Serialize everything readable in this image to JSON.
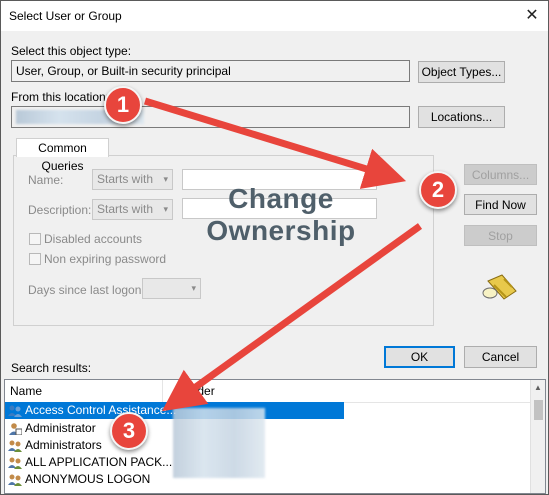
{
  "window": {
    "title": "Select User or Group"
  },
  "close_glyph": "✕",
  "object_type": {
    "label": "Select this object type:",
    "value": "User, Group, or Built-in security principal",
    "button": "Object Types..."
  },
  "location": {
    "label": "From this location:",
    "button": "Locations..."
  },
  "common_queries": {
    "tab": "Common Queries",
    "name_label": "Name:",
    "name_mode": "Starts with",
    "description_label": "Description:",
    "description_mode": "Starts with",
    "disabled_accounts": "Disabled accounts",
    "non_expiring": "Non expiring password",
    "days_label": "Days since last logon:"
  },
  "side_buttons": {
    "columns": "Columns...",
    "find_now": "Find Now",
    "stop": "Stop"
  },
  "ok_button": "OK",
  "cancel_button": "Cancel",
  "search_results": {
    "label": "Search results:",
    "columns": [
      "Name",
      "older"
    ],
    "rows": [
      "Access Control Assistance...",
      "Administrator",
      "Administrators",
      "ALL APPLICATION PACK...",
      "ANONYMOUS LOGON"
    ]
  },
  "annotations": {
    "watermark_line1": "Change",
    "watermark_line2": "Ownership",
    "steps": [
      "1",
      "2",
      "3"
    ],
    "arrow_color": "#e8453c"
  },
  "icons": [
    "close-icon",
    "find-flashlight-icon",
    "user-group-icon",
    "user-icon",
    "dropdown-arrow-icon"
  ]
}
